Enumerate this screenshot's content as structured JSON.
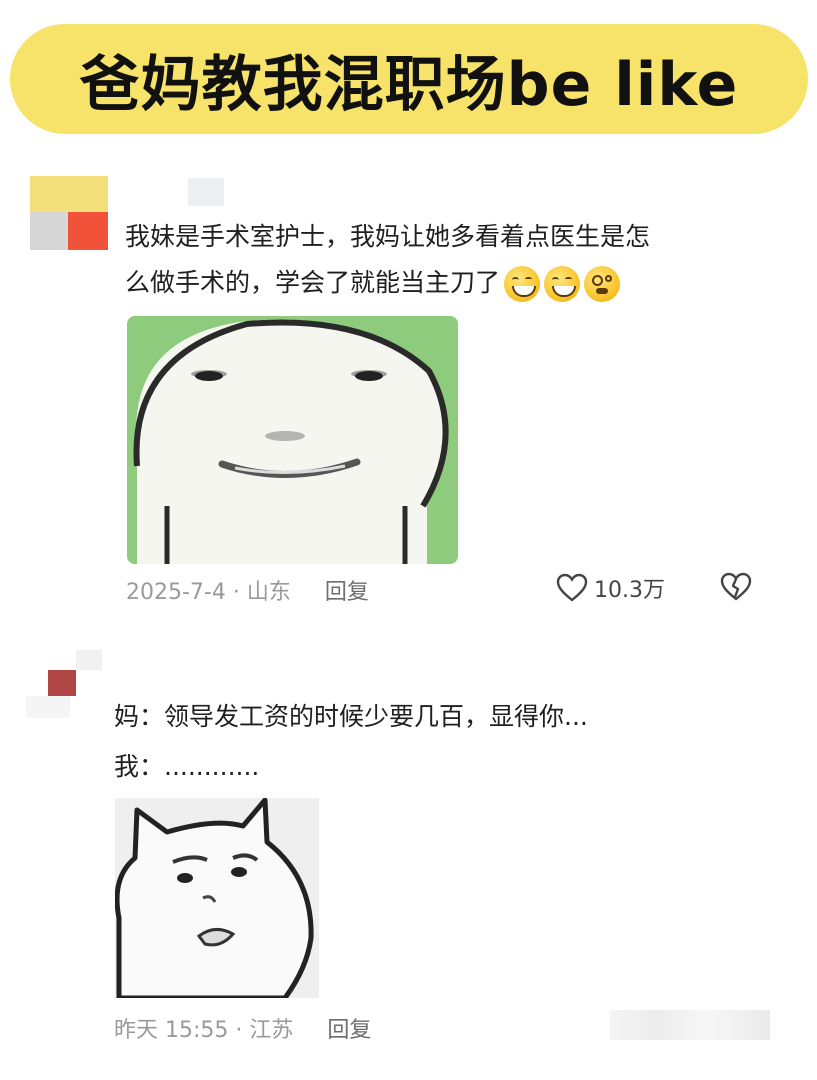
{
  "title": "爸妈教我混职场be like",
  "colors": {
    "banner": "#f7e36a",
    "meme1_bg": "#8fcb7c",
    "meta_text": "#9a9a9a"
  },
  "comments": [
    {
      "text_lines": [
        "我妹是手术室护士，我妈让她多看着点医生是怎",
        "么做手术的，学会了就能当主刀了"
      ],
      "emojis": [
        "grinning-sweat-emoji",
        "grinning-sweat-emoji",
        "flushed-emoji"
      ],
      "meta": "2025-7-4 · 山东",
      "reply_label": "回复",
      "likes": "10.3万"
    },
    {
      "text_lines": [
        "妈：领导发工资的时候少要几百，显得你...",
        "我：............"
      ],
      "meta": "昨天 15:55 · 江苏",
      "reply_label": "回复"
    }
  ]
}
